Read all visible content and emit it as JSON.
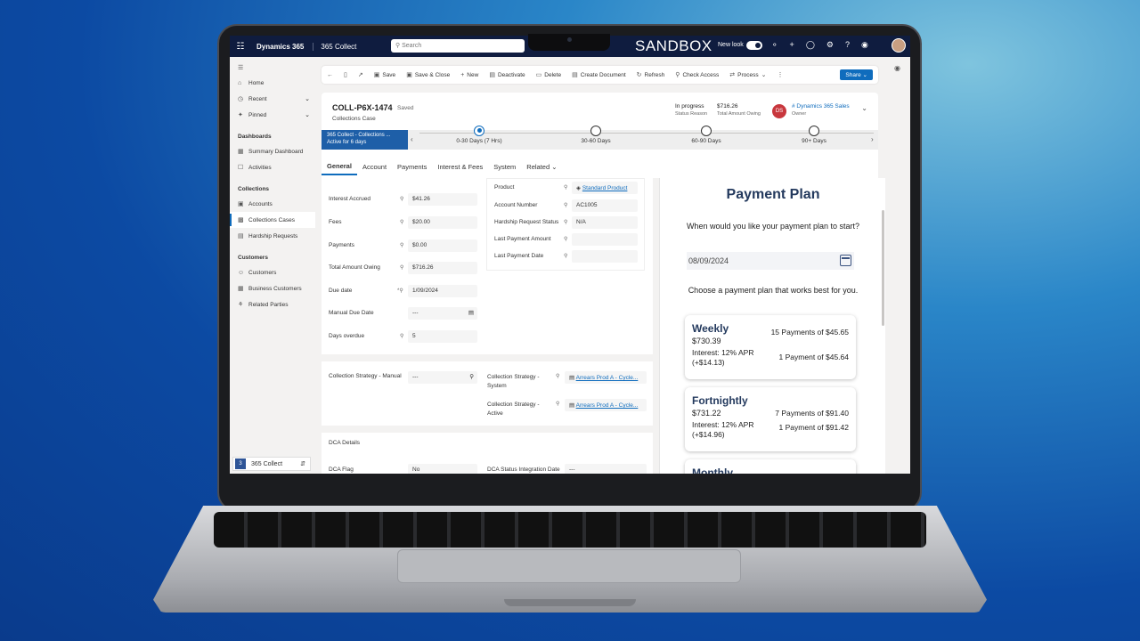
{
  "topbar": {
    "app_name": "Dynamics 365",
    "app_module": "365 Collect",
    "search_placeholder": "Search",
    "environment": "SANDBOX",
    "new_look_label": "New look"
  },
  "sidebar": {
    "top_items": [
      {
        "label": "Home",
        "icon": "home-icon"
      },
      {
        "label": "Recent",
        "icon": "clock-icon"
      },
      {
        "label": "Pinned",
        "icon": "pin-icon"
      }
    ],
    "sections": [
      {
        "heading": "Dashboards",
        "items": [
          "Summary Dashboard",
          "Activities"
        ]
      },
      {
        "heading": "Collections",
        "items": [
          "Accounts",
          "Collections Cases",
          "Hardship Requests"
        ]
      },
      {
        "heading": "Customers",
        "items": [
          "Customers",
          "Business Customers",
          "Related Parties"
        ]
      }
    ],
    "area_badge": "3",
    "area_label": "365 Collect"
  },
  "cmdbar": {
    "save": "Save",
    "save_close": "Save & Close",
    "new": "New",
    "deactivate": "Deactivate",
    "delete": "Delete",
    "create_document": "Create Document",
    "refresh": "Refresh",
    "check_access": "Check Access",
    "process": "Process",
    "share": "Share"
  },
  "header": {
    "record_title": "COLL-P6X-1474",
    "saved_status": "Saved",
    "record_type": "Collections Case",
    "status_reason_value": "In progress",
    "status_reason_label": "Status Reason",
    "amount_owing_value": "$716.26",
    "amount_owing_label": "Total Amount Owing",
    "owner_initials": "DS",
    "owner_value": "# Dynamics 365 Sales",
    "owner_label": "Owner"
  },
  "bpf": {
    "active_name": "365 Collect - Collections ...",
    "active_duration": "Active for 6 days",
    "stages": [
      {
        "label": "0-30 Days  (7 Hrs)",
        "active": true
      },
      {
        "label": "30-60 Days",
        "active": false
      },
      {
        "label": "60-90 Days",
        "active": false
      },
      {
        "label": "90+ Days",
        "active": false
      }
    ]
  },
  "tabs": [
    "General",
    "Account",
    "Payments",
    "Interest & Fees",
    "System",
    "Related"
  ],
  "form_left": [
    {
      "label": "Interest Accrued",
      "value": "$41.26"
    },
    {
      "label": "Fees",
      "value": "$20.00"
    },
    {
      "label": "Payments",
      "value": "$0.00"
    },
    {
      "label": "Total Amount Owing",
      "value": "$716.26"
    },
    {
      "label": "Due date",
      "value": "1/09/2024"
    },
    {
      "label": "Manual Due Date",
      "value": "---"
    },
    {
      "label": "Days overdue",
      "value": "5"
    }
  ],
  "form_right": [
    {
      "label": "Product",
      "value": "Standard Product"
    },
    {
      "label": "Account Number",
      "value": "AC1005"
    },
    {
      "label": "Hardship Request Status",
      "value": "N/A"
    },
    {
      "label": "Last Payment Amount",
      "value": ""
    },
    {
      "label": "Last Payment Date",
      "value": ""
    }
  ],
  "strategy": {
    "manual_label": "Collection Strategy - Manual",
    "manual_value": "---",
    "system_label": "Collection Strategy - System",
    "system_value": "Arrears Prod A - Cycle...",
    "active_label": "Collection Strategy - Active",
    "active_value": "Arrears Prod A - Cycle..."
  },
  "dca": {
    "heading": "DCA Details",
    "flag_label": "DCA Flag",
    "flag_value": "No",
    "status_label": "DCA Status Integration Date",
    "status_value": "---"
  },
  "payment_plan": {
    "title": "Payment Plan",
    "question": "When would you like your payment plan to start?",
    "start_date": "08/09/2024",
    "choose_text": "Choose a payment plan that works best for you.",
    "plans": [
      {
        "name": "Weekly",
        "amount": "$730.39",
        "interest": "Interest: 12% APR (+$14.13)",
        "payments": "15 Payments of $45.65",
        "final": "1 Payment of $45.64"
      },
      {
        "name": "Fortnightly",
        "amount": "$731.22",
        "interest": "Interest: 12% APR (+$14.96)",
        "payments": "7 Payments of $91.40",
        "final": "1 Payment of $91.42"
      },
      {
        "name": "Monthly"
      }
    ]
  },
  "colors": {
    "brand_dark": "#0f1c3f",
    "accent": "#0f6cbd",
    "plan_title": "#243a5e",
    "owner_badge": "#c8373d"
  }
}
